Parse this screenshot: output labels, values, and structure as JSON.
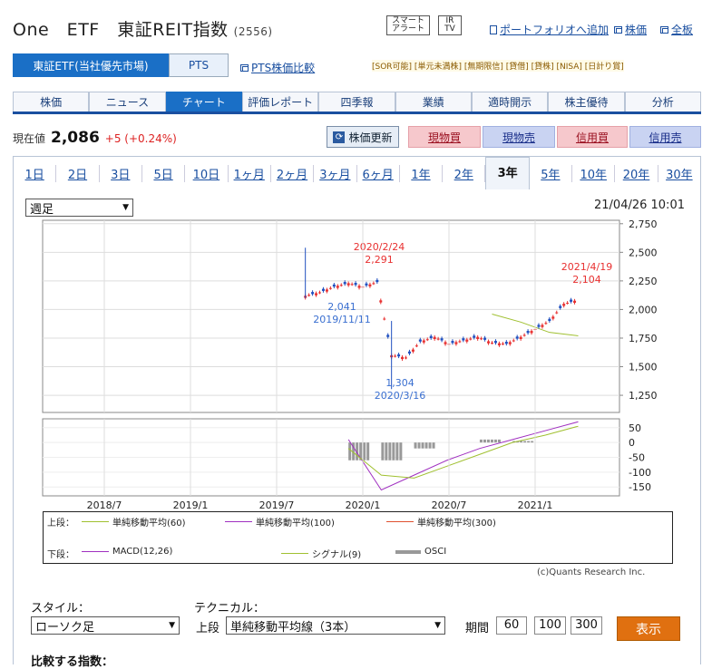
{
  "header": {
    "title": "One　ETF　東証REIT指数",
    "code": "(2556)",
    "smart_alert": [
      "スマート",
      "アラート"
    ],
    "irtv": [
      "IR",
      "TV"
    ],
    "links": [
      "ポートフォリオへ追加",
      "株価",
      "全板"
    ]
  },
  "market": {
    "tabs": [
      "東証ETF(当社優先市場)",
      "PTS"
    ],
    "pts_compare": "PTS株価比較",
    "tags": "[SOR可能] [単元未満株] [無期限信] [貸借] [貸株] [NISA] [日計り賞]"
  },
  "nav": {
    "tabs": [
      "株価",
      "ニュース",
      "チャート",
      "評価レポート",
      "四季報",
      "業績",
      "適時開示",
      "株主優待",
      "分析"
    ],
    "active": 2
  },
  "price": {
    "label": "現在値",
    "value": "2,086",
    "change": "+5 (+0.24%)",
    "update": "株価更新",
    "buttons": [
      "現物買",
      "現物売",
      "信用買",
      "信用売"
    ]
  },
  "periods": {
    "items": [
      "1日",
      "2日",
      "3日",
      "5日",
      "10日",
      "1ヶ月",
      "2ヶ月",
      "3ヶ月",
      "6ヶ月",
      "1年",
      "2年",
      "3年",
      "5年",
      "10年",
      "20年",
      "30年"
    ],
    "active": 11
  },
  "chart_controls": {
    "interval": "週足",
    "timestamp": "21/04/26 10:01"
  },
  "colors": {
    "up": "#e83030",
    "down": "#2050c0",
    "ma60": "#a0c030",
    "ma100": "#a030c0",
    "ma300": "#e05030",
    "macd": "#a030c0",
    "signal": "#a0c030",
    "osci": "#999999"
  },
  "chart_data": [
    {
      "type": "line",
      "title": "",
      "y_ticks": [
        "2,750",
        "2,500",
        "2,250",
        "2,000",
        "1,750",
        "1,500",
        "1,250"
      ],
      "ylim": [
        1100,
        2780
      ],
      "x_ticks": [
        "2018/7",
        "2019/1",
        "2019/7",
        "2020/1",
        "2020/7",
        "2021/1"
      ],
      "annotations": [
        {
          "lines": [
            "2020/2/24",
            "2,291"
          ],
          "color": "#e83030"
        },
        {
          "lines": [
            "2,041",
            "2019/11/11"
          ],
          "color": "#3a6fd0"
        },
        {
          "lines": [
            "1,304",
            "2020/3/16"
          ],
          "color": "#3a6fd0"
        },
        {
          "lines": [
            "2021/4/19",
            "2,104"
          ],
          "color": "#e83030"
        }
      ],
      "series": [
        {
          "name": "price",
          "x": [
            "2019/9",
            "2019/10",
            "2019/11",
            "2019/12",
            "2020/1",
            "2020/2",
            "2020/3",
            "2020/4",
            "2020/5",
            "2020/6",
            "2020/7",
            "2020/8",
            "2020/9",
            "2020/10",
            "2020/11",
            "2020/12",
            "2021/1",
            "2021/2",
            "2021/3",
            "2021/4"
          ],
          "values": [
            2120,
            2150,
            2200,
            2230,
            2200,
            2240,
            1600,
            1580,
            1720,
            1760,
            1700,
            1730,
            1760,
            1710,
            1700,
            1760,
            1830,
            1900,
            2050,
            2086
          ]
        },
        {
          "name": "単純移動平均(60)",
          "x": [
            "2020/10",
            "2020/12",
            "2021/2",
            "2021/4"
          ],
          "values": [
            1960,
            1890,
            1800,
            1770
          ]
        }
      ]
    },
    {
      "type": "bar",
      "title": "",
      "y_ticks": [
        "50",
        "0",
        "-50",
        "-100",
        "-150"
      ],
      "ylim": [
        -180,
        80
      ],
      "series": [
        {
          "name": "MACD(12,26)",
          "values": [
            10,
            -160,
            -110,
            -60,
            -20,
            10,
            40,
            70
          ]
        },
        {
          "name": "シグナル(9)",
          "values": [
            -20,
            -110,
            -120,
            -80,
            -40,
            0,
            25,
            55
          ]
        },
        {
          "name": "OSCI",
          "values": [
            -60,
            -60,
            -20,
            0,
            10,
            5,
            0,
            0
          ]
        }
      ]
    }
  ],
  "legend": {
    "top_label": "上段：",
    "bottom_label": "下段：",
    "top": [
      "単純移動平均(60)",
      "単純移動平均(100)",
      "単純移動平均(300)"
    ],
    "bottom": [
      "MACD(12,26)",
      "シグナル(9)",
      "OSCI"
    ]
  },
  "copyright": "(c)Quants Research Inc.",
  "controls": {
    "style_label": "スタイル：",
    "style_value": "ローソク足",
    "tech_label": "テクニカル：",
    "upper": "上段",
    "tech_value": "単純移動平均線（3本）",
    "period_label": "期間",
    "periods": [
      "60",
      "100",
      "300"
    ],
    "show": "表示",
    "compare": "比較する指数："
  }
}
